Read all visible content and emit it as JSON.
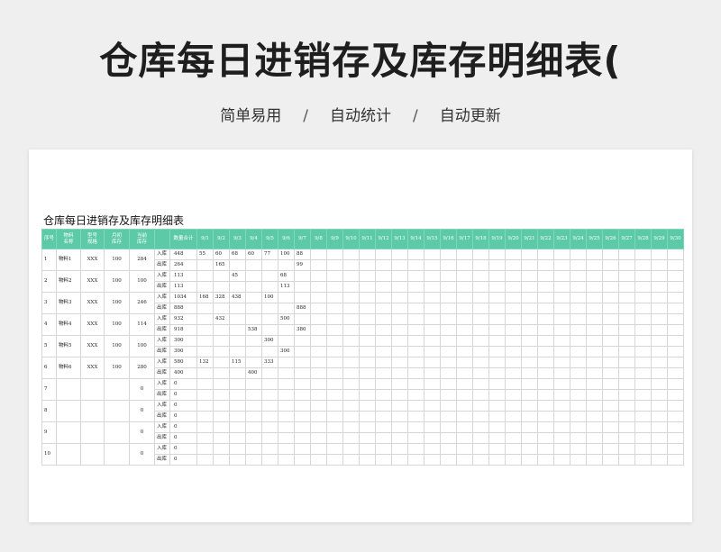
{
  "header": {
    "title": "仓库每日进销存及库存明细表(",
    "subtitle_items": [
      "简单易用",
      "自动统计",
      "自动更新"
    ],
    "separator": "/"
  },
  "sheet": {
    "title": "仓库每日进销存及库存明细表",
    "accent_color": "#5ccaa6",
    "columns": {
      "seq": "序号",
      "name": [
        "物料",
        "名称"
      ],
      "model": [
        "型号",
        "规格"
      ],
      "opening": [
        "月初",
        "库存"
      ],
      "current": [
        "当前",
        "库存"
      ],
      "qty_total": "数量合计",
      "dates": [
        "9/1",
        "9/2",
        "9/3",
        "9/4",
        "9/5",
        "9/6",
        "9/7",
        "9/8",
        "9/9",
        "9/10",
        "9/11",
        "9/12",
        "9/13",
        "9/14",
        "9/15",
        "9/16",
        "9/17",
        "9/18",
        "9/19",
        "9/20",
        "9/21",
        "9/22",
        "9/23",
        "9/24",
        "9/25",
        "9/26",
        "9/27",
        "9/28",
        "9/29",
        "9/30"
      ]
    },
    "labels": {
      "in": "入库",
      "out": "出库"
    },
    "rows": [
      {
        "seq": "1",
        "name": "物料1",
        "model": "XXX",
        "opening": "100",
        "current": "284",
        "in_total": "448",
        "in_days": {
          "0": "55",
          "1": "60",
          "2": "68",
          "3": "60",
          "4": "77",
          "5": "100",
          "6": "88"
        },
        "out_total": "264",
        "out_days": {
          "1": "165",
          "6": "99"
        }
      },
      {
        "seq": "2",
        "name": "物料2",
        "model": "XXX",
        "opening": "100",
        "current": "100",
        "in_total": "113",
        "in_days": {
          "2": "45",
          "5": "68"
        },
        "out_total": "113",
        "out_days": {
          "5": "113"
        }
      },
      {
        "seq": "3",
        "name": "物料3",
        "model": "XXX",
        "opening": "100",
        "current": "246",
        "in_total": "1034",
        "in_days": {
          "0": "168",
          "1": "328",
          "2": "438",
          "4": "100"
        },
        "out_total": "888",
        "out_days": {
          "6": "888"
        }
      },
      {
        "seq": "4",
        "name": "物料4",
        "model": "XXX",
        "opening": "100",
        "current": "114",
        "in_total": "932",
        "in_days": {
          "1": "432",
          "5": "500"
        },
        "out_total": "918",
        "out_days": {
          "3": "538",
          "6": "380"
        }
      },
      {
        "seq": "5",
        "name": "物料5",
        "model": "XXX",
        "opening": "100",
        "current": "100",
        "in_total": "300",
        "in_days": {
          "4": "300"
        },
        "out_total": "300",
        "out_days": {
          "5": "300"
        }
      },
      {
        "seq": "6",
        "name": "物料6",
        "model": "XXX",
        "opening": "100",
        "current": "280",
        "in_total": "580",
        "in_days": {
          "0": "132",
          "2": "115",
          "4": "333"
        },
        "out_total": "400",
        "out_days": {
          "3": "400"
        }
      },
      {
        "seq": "7",
        "name": "",
        "model": "",
        "opening": "",
        "current": "0",
        "in_total": "0",
        "in_days": {},
        "out_total": "0",
        "out_days": {}
      },
      {
        "seq": "8",
        "name": "",
        "model": "",
        "opening": "",
        "current": "0",
        "in_total": "0",
        "in_days": {},
        "out_total": "0",
        "out_days": {}
      },
      {
        "seq": "9",
        "name": "",
        "model": "",
        "opening": "",
        "current": "0",
        "in_total": "0",
        "in_days": {},
        "out_total": "0",
        "out_days": {}
      },
      {
        "seq": "10",
        "name": "",
        "model": "",
        "opening": "",
        "current": "0",
        "in_total": "0",
        "in_days": {},
        "out_total": "0",
        "out_days": {}
      }
    ]
  }
}
